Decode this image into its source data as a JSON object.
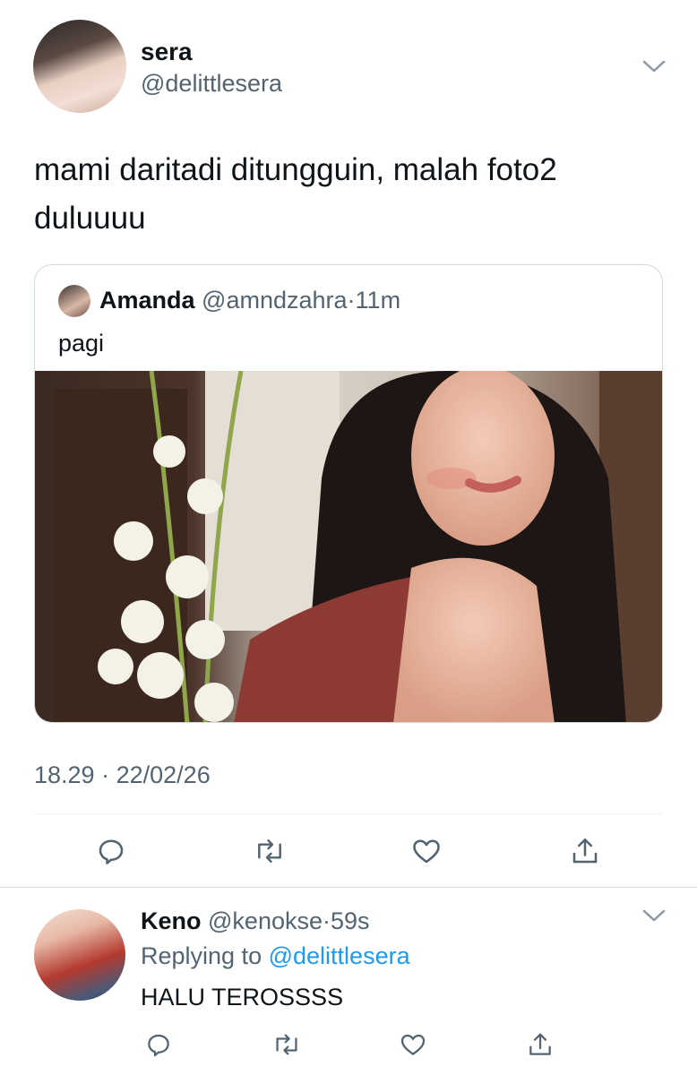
{
  "tweet": {
    "author_name": "sera",
    "author_handle": "@delittlesera",
    "text": "mami daritadi ditungguin, malah foto2 duluuuu",
    "time": "18.29",
    "separator": "·",
    "date": "22/02/26"
  },
  "quote": {
    "author_name": "Amanda",
    "author_handle": "@amndzahra",
    "separator": "·",
    "time_ago": "11m",
    "text": "pagi"
  },
  "reply": {
    "author_name": "Keno",
    "author_handle": "@kenokse",
    "separator": "·",
    "time_ago": "59s",
    "replying_prefix": "Replying to",
    "replying_handle": "@delittlesera",
    "text": "HALU TEROSSSS"
  },
  "actions": [
    "comment-icon",
    "retweet-icon",
    "like-icon",
    "share-icon"
  ],
  "colors": {
    "text": "#0f1419",
    "muted": "#536471",
    "link": "#1d9bf0",
    "border": "#cfd9de"
  }
}
